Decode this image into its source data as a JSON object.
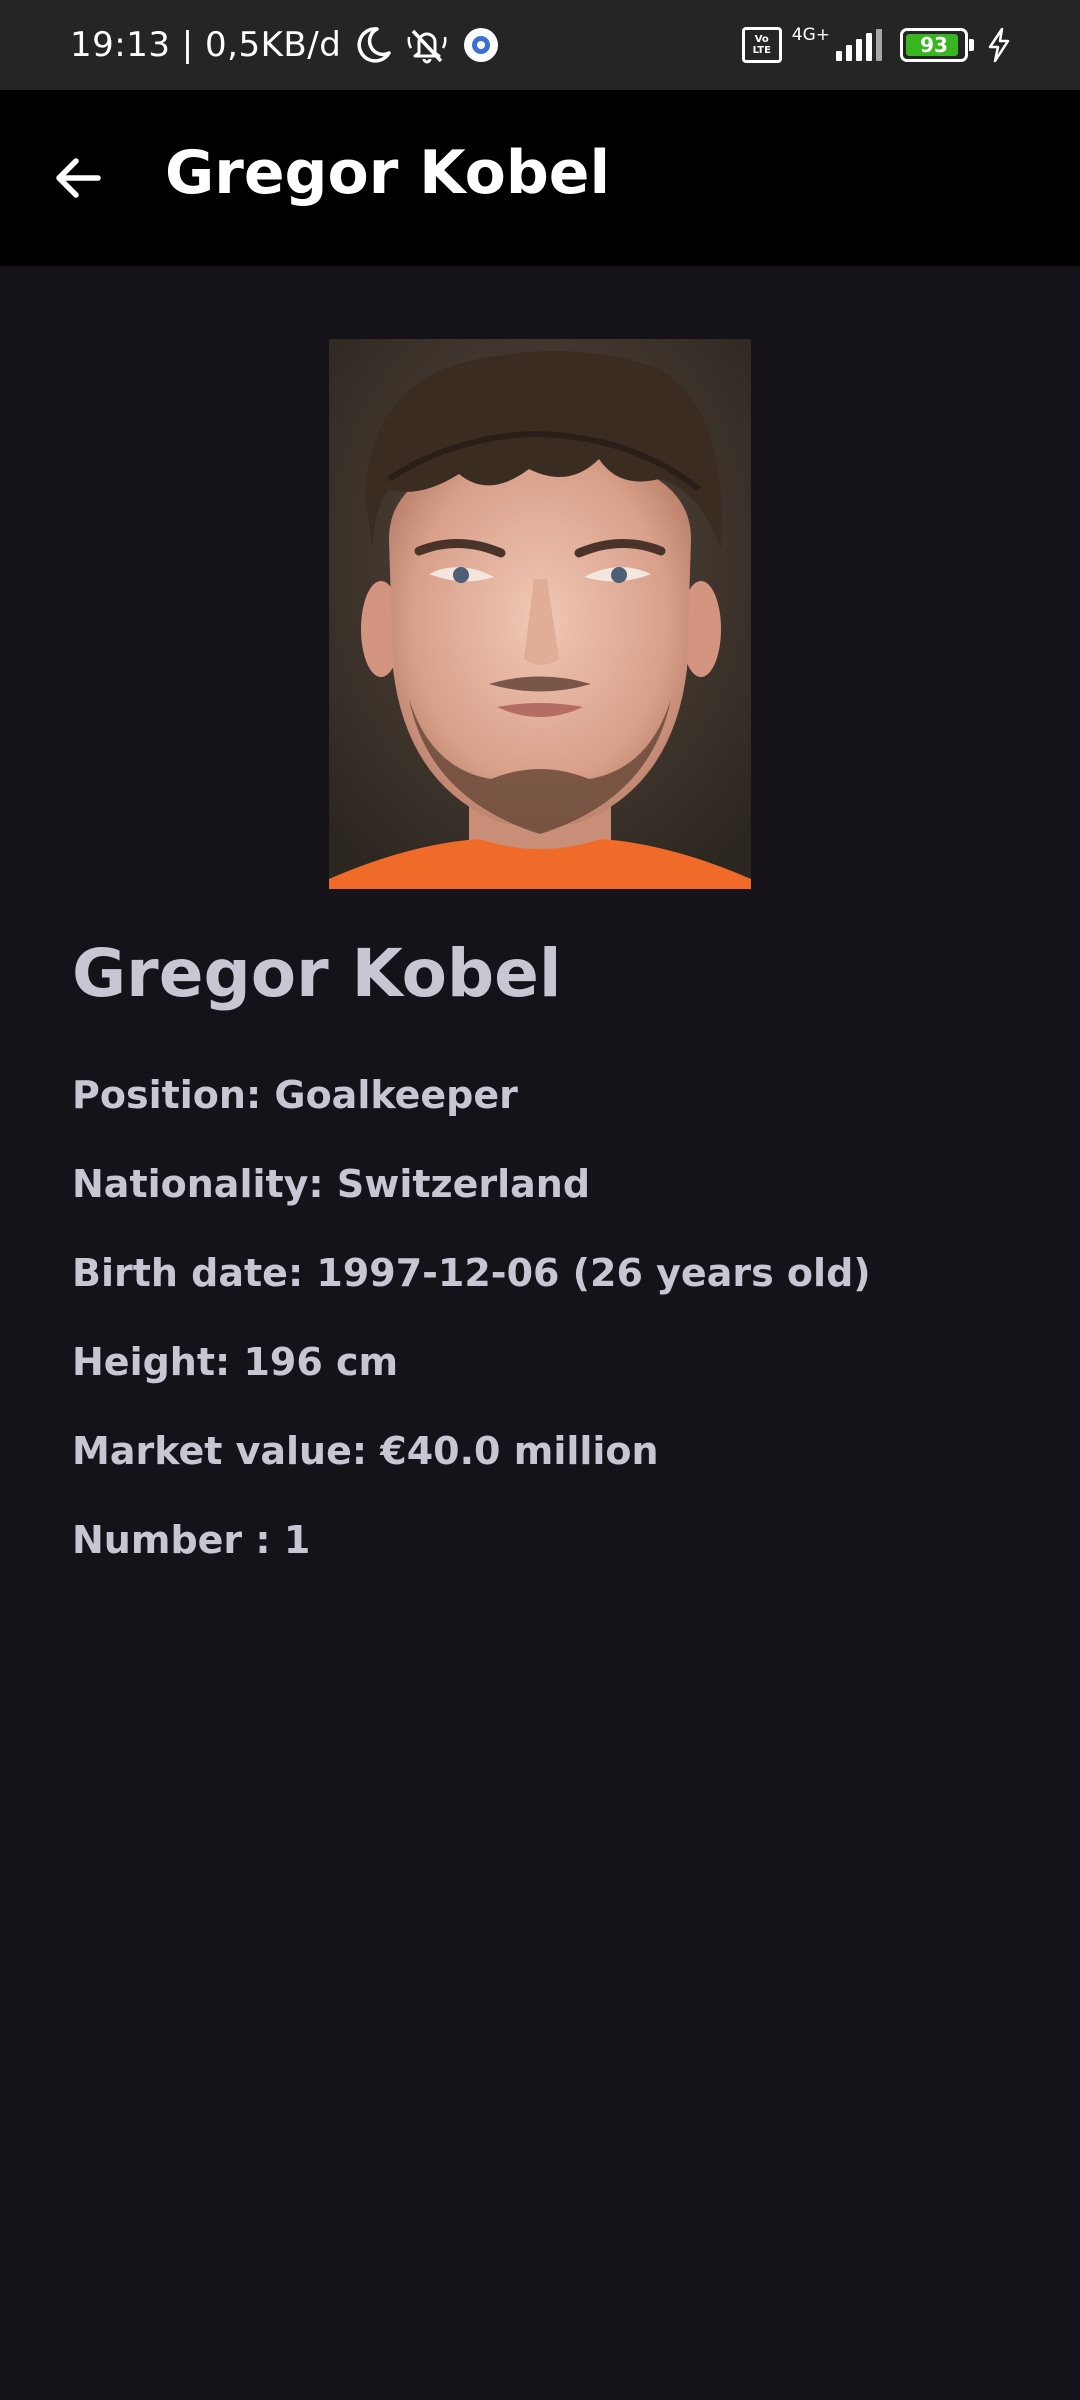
{
  "status_bar": {
    "time_net": "19:13 | 0,5KB/d",
    "volte_top": "Vo",
    "volte_bottom": "LTE",
    "network_type": "4G+",
    "battery": "93",
    "battery_level": 0.93,
    "icons": [
      "moon-icon",
      "notifications-off-icon",
      "app-notification-icon",
      "volte-icon",
      "signal-icon",
      "battery-icon",
      "charging-icon"
    ]
  },
  "app_bar": {
    "title": "Gregor Kobel",
    "back_icon": "arrow-left-icon"
  },
  "player": {
    "name": "Gregor Kobel",
    "position": "Position: Goalkeeper",
    "nationality": "Nationality: Switzerland",
    "birth_date": "Birth date: 1997-12-06 (26 years old)",
    "height": "Height: 196 cm",
    "market_value": "Market value: €40.0 million",
    "number": "Number : 1"
  },
  "colors": {
    "background": "#15121a",
    "status_bar": "#252525",
    "app_bar": "#000000",
    "text": "#c9c5d2",
    "battery_fill": "#38b51f"
  }
}
